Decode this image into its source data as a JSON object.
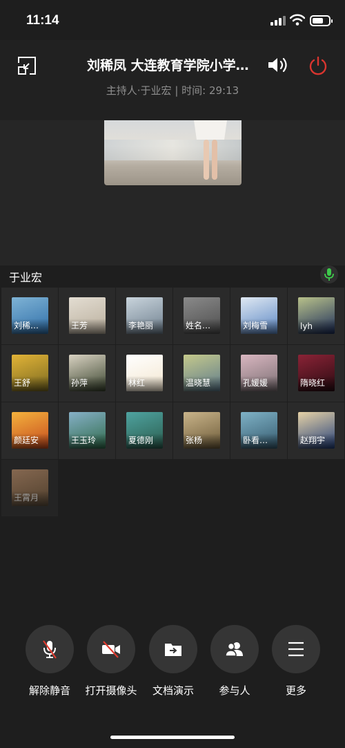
{
  "status_bar": {
    "time": "11:14"
  },
  "header": {
    "title": "刘稀凤 大连教育学院小学…",
    "subtitle": "主持人·于业宏 | 时间: 29:13",
    "power_color": "#d9352f"
  },
  "speaker": {
    "name": "于业宏",
    "mic_color": "#3ec94b"
  },
  "participants": [
    {
      "name": "刘稀…",
      "colors": [
        "#2f6ea8",
        "#7fb3d5"
      ]
    },
    {
      "name": "王芳",
      "colors": [
        "#b9ae9c",
        "#e3ddd2"
      ]
    },
    {
      "name": "李艳丽",
      "colors": [
        "#6e7f8e",
        "#c9d4dc"
      ]
    },
    {
      "name": "姓名…",
      "colors": [
        "#4d4d4d",
        "#8a8a8a"
      ]
    },
    {
      "name": "刘梅雪",
      "colors": [
        "#5b87c4",
        "#dfe8f2"
      ]
    },
    {
      "name": "lyh",
      "colors": [
        "#1d2d5a",
        "#b8c18a"
      ]
    },
    {
      "name": "王舒",
      "colors": [
        "#7a6a21",
        "#e2b337"
      ]
    },
    {
      "name": "孙萍",
      "colors": [
        "#39442e",
        "#d9d2c2"
      ]
    },
    {
      "name": "林红",
      "colors": [
        "#f3e6cf",
        "#ffffff"
      ]
    },
    {
      "name": "温晓慧",
      "colors": [
        "#5e7b8d",
        "#c5c98b"
      ]
    },
    {
      "name": "孔媛媛",
      "colors": [
        "#7a6f73",
        "#d9b6c0"
      ]
    },
    {
      "name": "隋晓红",
      "colors": [
        "#2a0b12",
        "#8a2336"
      ]
    },
    {
      "name": "颜廷安",
      "colors": [
        "#c54a1e",
        "#f4b23d"
      ]
    },
    {
      "name": "王玉玲",
      "colors": [
        "#2f6b4a",
        "#86b0c7"
      ]
    },
    {
      "name": "夏德刚",
      "colors": [
        "#2a5c4d",
        "#4fa3a0"
      ]
    },
    {
      "name": "张杨",
      "colors": [
        "#6c5a38",
        "#c9b48a"
      ]
    },
    {
      "name": "卧看…",
      "colors": [
        "#355a6e",
        "#7fb2c6"
      ]
    },
    {
      "name": "赵翔宇",
      "colors": [
        "#233f7a",
        "#e6d2a6"
      ]
    },
    {
      "name": "王霄月",
      "colors": [
        "#7a5c3a",
        "#d9a47a"
      ]
    }
  ],
  "controls": [
    {
      "label": "解除静音",
      "icon": "mic-off-icon"
    },
    {
      "label": "打开摄像头",
      "icon": "camera-off-icon"
    },
    {
      "label": "文档演示",
      "icon": "document-share-icon"
    },
    {
      "label": "参与人",
      "icon": "participants-icon"
    },
    {
      "label": "更多",
      "icon": "more-menu-icon"
    }
  ]
}
